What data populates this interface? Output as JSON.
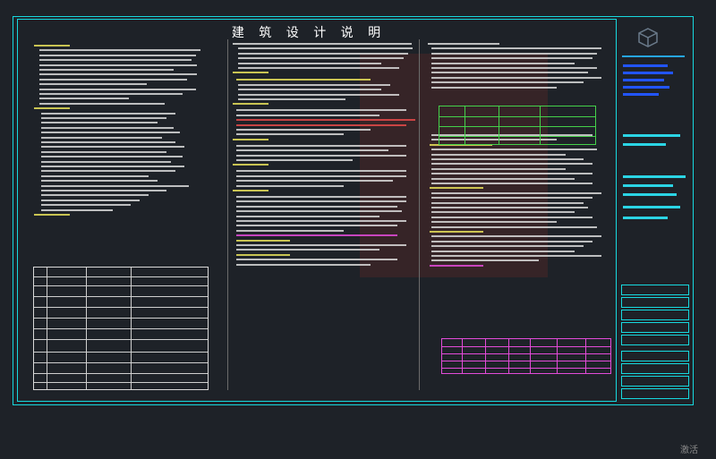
{
  "sheet": {
    "title": "建 筑 设 计 说 明",
    "corner_text": "激活"
  },
  "colors": {
    "background": "#1e2228",
    "frame": "#17d9df",
    "text_white": "#d9d9d9",
    "text_yellow": "#e8e05a",
    "text_green": "#44d14a",
    "text_cyan": "#26d7e8",
    "text_magenta": "#e34bd9",
    "text_red": "#e44a4a",
    "accent_blue": "#2255ff"
  },
  "icons": {
    "logo": "cube-logo-icon"
  }
}
